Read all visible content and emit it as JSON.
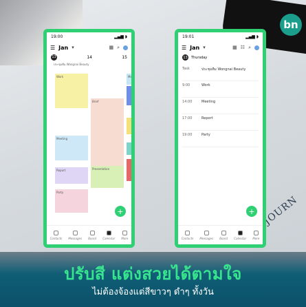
{
  "brand": "bn",
  "watermark": "JOURN",
  "phone_left": {
    "status_time": "19:00",
    "month": "Jan",
    "day_a": "13",
    "day_b": "14",
    "day_c": "15",
    "pinned": "ประชุมทีม Wongnai Beauty",
    "events": [
      {
        "label": "Work",
        "color": "#f7f1a5"
      },
      {
        "label": "Meeting",
        "color": "#cfe8f7"
      },
      {
        "label": "Report",
        "color": "#ded6f4"
      },
      {
        "label": "Party",
        "color": "#f6d4de"
      },
      {
        "label": "Presentation",
        "color": "#d8f0b6"
      },
      {
        "label": "Meeting",
        "color": "#c7e6f5"
      },
      {
        "label": "Brief",
        "color": "#f7dcd2"
      }
    ],
    "tabs": [
      "Contacts",
      "Messages",
      "Board",
      "Calendar",
      "More"
    ]
  },
  "phone_right": {
    "status_time": "19:01",
    "month": "Jan",
    "date_num": "13",
    "weekday": "Thursday",
    "rows": [
      {
        "time": "Task",
        "text": "ประชุมทีม Wongnai Beauty"
      },
      {
        "time": "9:00",
        "text": "Work"
      },
      {
        "time": "14:00",
        "text": "Meeting"
      },
      {
        "time": "17:00",
        "text": "Report"
      },
      {
        "time": "19:00",
        "text": "Party"
      }
    ],
    "tabs": [
      "Contacts",
      "Messages",
      "Board",
      "Calendar",
      "More"
    ]
  },
  "headline": "ปรับสี แต่งสวยได้ตามใจ",
  "subtext": "ไม่ต้องจ้องแต่สีขาวๆ ดำๆ ทั้งวัน"
}
